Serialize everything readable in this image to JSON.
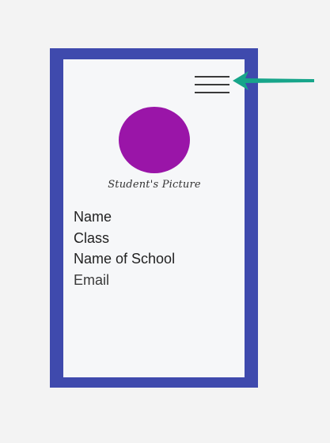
{
  "card": {
    "caption": "Student's Picture",
    "fields": {
      "name": "Name",
      "class": "Class",
      "school": "Name of School",
      "email": "Email"
    },
    "menu_icon": "hamburger-menu-icon"
  },
  "colors": {
    "frame": "#3f4aad",
    "avatar": "#9a15a8",
    "arrow": "#17a58a",
    "background": "#f3f3f3"
  }
}
